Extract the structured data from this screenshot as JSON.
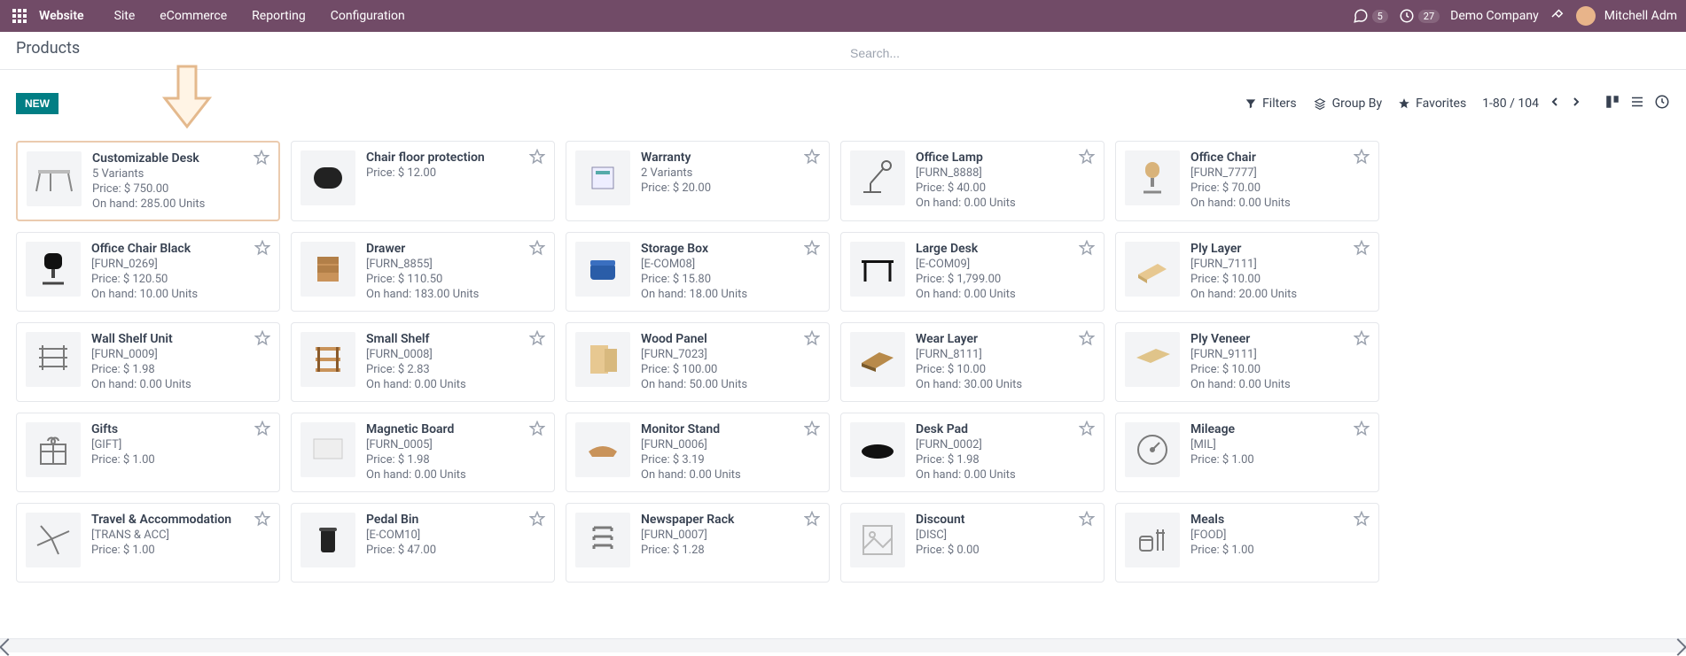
{
  "nav": {
    "brand": "Website",
    "links": [
      "Site",
      "eCommerce",
      "Reporting",
      "Configuration"
    ],
    "messages_badge": "5",
    "activities_badge": "27",
    "company": "Demo Company",
    "user": "Mitchell Adm"
  },
  "header": {
    "title": "Products",
    "search_placeholder": "Search..."
  },
  "toolbar": {
    "new_label": "NEW",
    "filters_label": "Filters",
    "groupby_label": "Group By",
    "favorites_label": "Favorites",
    "pager": "1-80 / 104"
  },
  "products": [
    {
      "title": "Customizable Desk",
      "sku": "",
      "variants": "5 Variants",
      "price": "Price: $ 750.00",
      "onhand": "On hand: 285.00 Units",
      "highlight": true,
      "thumb": "desk"
    },
    {
      "title": "Chair floor protection",
      "sku": "",
      "variants": "",
      "price": "Price: $ 12.00",
      "onhand": "",
      "thumb": "mat"
    },
    {
      "title": "Warranty",
      "sku": "",
      "variants": "2 Variants",
      "price": "Price: $ 20.00",
      "onhand": "",
      "thumb": "box"
    },
    {
      "title": "Office Lamp",
      "sku": "[FURN_8888]",
      "variants": "",
      "price": "Price: $ 40.00",
      "onhand": "On hand: 0.00 Units",
      "thumb": "lamp"
    },
    {
      "title": "Office Chair",
      "sku": "[FURN_7777]",
      "variants": "",
      "price": "Price: $ 70.00",
      "onhand": "On hand: 0.00 Units",
      "thumb": "chair"
    },
    {
      "title": "Office Chair Black",
      "sku": "[FURN_0269]",
      "variants": "",
      "price": "Price: $ 120.50",
      "onhand": "On hand: 10.00 Units",
      "thumb": "chair2"
    },
    {
      "title": "Drawer",
      "sku": "[FURN_8855]",
      "variants": "",
      "price": "Price: $ 110.50",
      "onhand": "On hand: 183.00 Units",
      "thumb": "drawer"
    },
    {
      "title": "Storage Box",
      "sku": "[E-COM08]",
      "variants": "",
      "price": "Price: $ 15.80",
      "onhand": "On hand: 18.00 Units",
      "thumb": "storage"
    },
    {
      "title": "Large Desk",
      "sku": "[E-COM09]",
      "variants": "",
      "price": "Price: $ 1,799.00",
      "onhand": "On hand: 0.00 Units",
      "thumb": "bigdesk"
    },
    {
      "title": "Ply Layer",
      "sku": "[FURN_7111]",
      "variants": "",
      "price": "Price: $ 10.00",
      "onhand": "On hand: 20.00 Units",
      "thumb": "ply"
    },
    {
      "title": "Wall Shelf Unit",
      "sku": "[FURN_0009]",
      "variants": "",
      "price": "Price: $ 1.98",
      "onhand": "On hand: 0.00 Units",
      "thumb": "wallshelf"
    },
    {
      "title": "Small Shelf",
      "sku": "[FURN_0008]",
      "variants": "",
      "price": "Price: $ 2.83",
      "onhand": "On hand: 0.00 Units",
      "thumb": "smallshelf"
    },
    {
      "title": "Wood Panel",
      "sku": "[FURN_7023]",
      "variants": "",
      "price": "Price: $ 100.00",
      "onhand": "On hand: 50.00 Units",
      "thumb": "panel"
    },
    {
      "title": "Wear Layer",
      "sku": "[FURN_8111]",
      "variants": "",
      "price": "Price: $ 10.00",
      "onhand": "On hand: 30.00 Units",
      "thumb": "wear"
    },
    {
      "title": "Ply Veneer",
      "sku": "[FURN_9111]",
      "variants": "",
      "price": "Price: $ 10.00",
      "onhand": "On hand: 0.00 Units",
      "thumb": "veneer"
    },
    {
      "title": "Gifts",
      "sku": "[GIFT]",
      "variants": "",
      "price": "Price: $ 1.00",
      "onhand": "",
      "thumb": "gift"
    },
    {
      "title": "Magnetic Board",
      "sku": "[FURN_0005]",
      "variants": "",
      "price": "Price: $ 1.98",
      "onhand": "On hand: 0.00 Units",
      "thumb": "board"
    },
    {
      "title": "Monitor Stand",
      "sku": "[FURN_0006]",
      "variants": "",
      "price": "Price: $ 3.19",
      "onhand": "On hand: 0.00 Units",
      "thumb": "stand"
    },
    {
      "title": "Desk Pad",
      "sku": "[FURN_0002]",
      "variants": "",
      "price": "Price: $ 1.98",
      "onhand": "On hand: 0.00 Units",
      "thumb": "pad"
    },
    {
      "title": "Mileage",
      "sku": "[MIL]",
      "variants": "",
      "price": "Price: $ 1.00",
      "onhand": "",
      "thumb": "mileage"
    },
    {
      "title": "Travel & Accommodation",
      "sku": "[TRANS & ACC]",
      "variants": "",
      "price": "Price: $ 1.00",
      "onhand": "",
      "thumb": "plane"
    },
    {
      "title": "Pedal Bin",
      "sku": "[E-COM10]",
      "variants": "",
      "price": "Price: $ 47.00",
      "onhand": "",
      "thumb": "bin"
    },
    {
      "title": "Newspaper Rack",
      "sku": "[FURN_0007]",
      "variants": "",
      "price": "Price: $ 1.28",
      "onhand": "",
      "thumb": "rack"
    },
    {
      "title": "Discount",
      "sku": "[DISC]",
      "variants": "",
      "price": "Price: $ 0.00",
      "onhand": "",
      "thumb": "generic"
    },
    {
      "title": "Meals",
      "sku": "[FOOD]",
      "variants": "",
      "price": "Price: $ 1.00",
      "onhand": "",
      "thumb": "meals"
    }
  ]
}
